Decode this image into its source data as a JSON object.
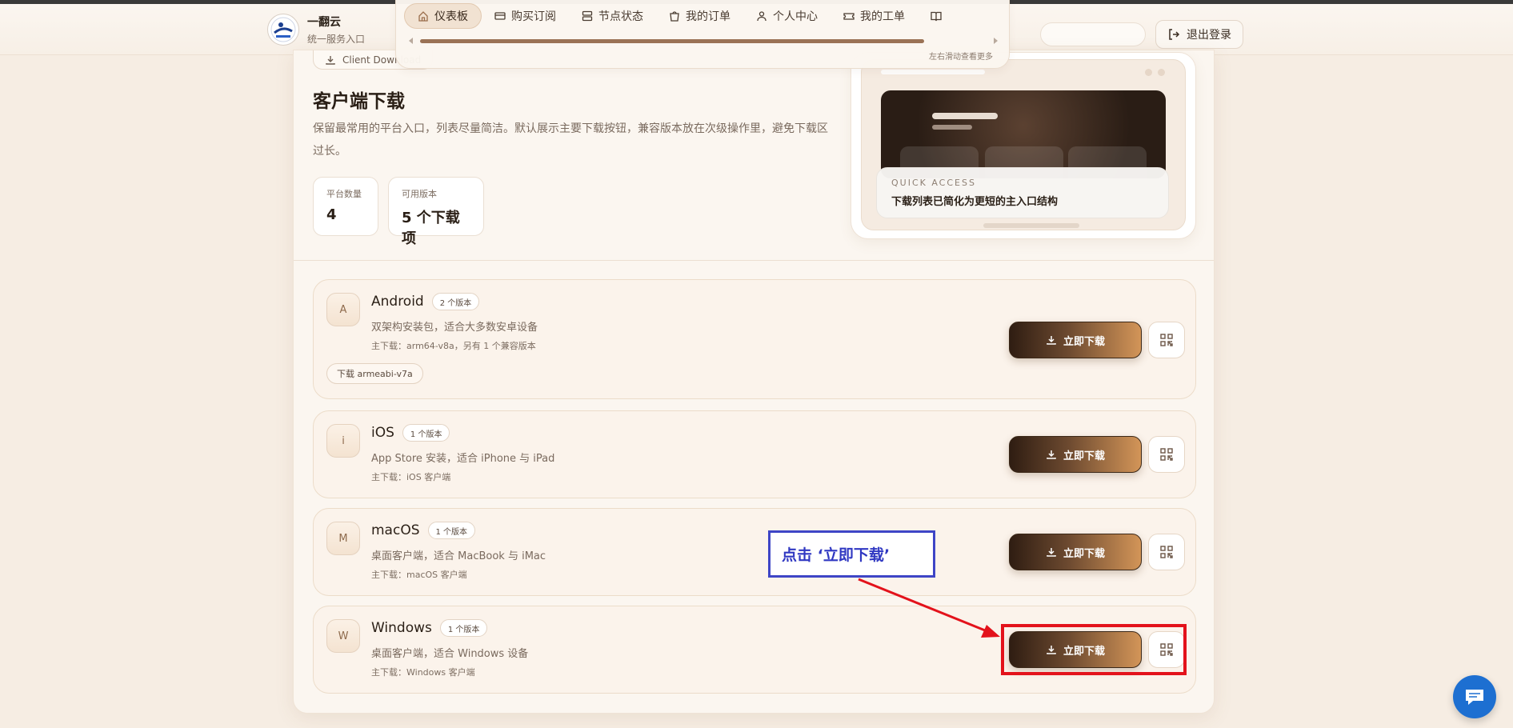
{
  "brand": {
    "name": "一翻云",
    "subtitle": "统一服务入口"
  },
  "nav": {
    "items": [
      {
        "label": "仪表板",
        "icon": "home-icon",
        "active": true
      },
      {
        "label": "购买订阅",
        "icon": "card-icon",
        "active": false
      },
      {
        "label": "节点状态",
        "icon": "server-icon",
        "active": false
      },
      {
        "label": "我的订单",
        "icon": "bag-icon",
        "active": false
      },
      {
        "label": "个人中心",
        "icon": "user-icon",
        "active": false
      },
      {
        "label": "我的工单",
        "icon": "ticket-icon",
        "active": false
      },
      {
        "label": "",
        "icon": "book-icon",
        "active": false
      }
    ],
    "scroll_hint": "左右滑动查看更多"
  },
  "header": {
    "logout_label": "退出登录"
  },
  "page": {
    "tag": "Client Download",
    "title": "客户端下载",
    "description": "保留最常用的平台入口，列表尽量简洁。默认展示主要下载按钮，兼容版本放在次级操作里，避免下载区过长。",
    "stats": [
      {
        "label": "平台数量",
        "value": "4"
      },
      {
        "label": "可用版本",
        "value": "5 个下载项"
      }
    ]
  },
  "preview": {
    "quick_label": "QUICK ACCESS",
    "quick_text": "下载列表已简化为更短的主入口结构"
  },
  "platforms": [
    {
      "initial": "A",
      "name": "Android",
      "badge": "2 个版本",
      "desc": "双架构安装包，适合大多数安卓设备",
      "main": "主下载：arm64-v8a，另有 1 个兼容版本",
      "alt": "下载 armeabi-v7a",
      "button": "立即下载"
    },
    {
      "initial": "i",
      "name": "iOS",
      "badge": "1 个版本",
      "desc": "App Store 安装，适合 iPhone 与 iPad",
      "main": "主下载：iOS 客户端",
      "button": "立即下载"
    },
    {
      "initial": "M",
      "name": "macOS",
      "badge": "1 个版本",
      "desc": "桌面客户端，适合 MacBook 与 iMac",
      "main": "主下载：macOS 客户端",
      "button": "立即下载"
    },
    {
      "initial": "W",
      "name": "Windows",
      "badge": "1 个版本",
      "desc": "桌面客户端，适合 Windows 设备",
      "main": "主下载：Windows 客户端",
      "button": "立即下载"
    }
  ],
  "annotation": {
    "text": "点击 ‘立即下载’"
  },
  "colors": {
    "accent": "#c48a52",
    "annotation_box": "#3e45c6",
    "annotation_target": "#e3121b",
    "chat": "#1d6fd1"
  }
}
